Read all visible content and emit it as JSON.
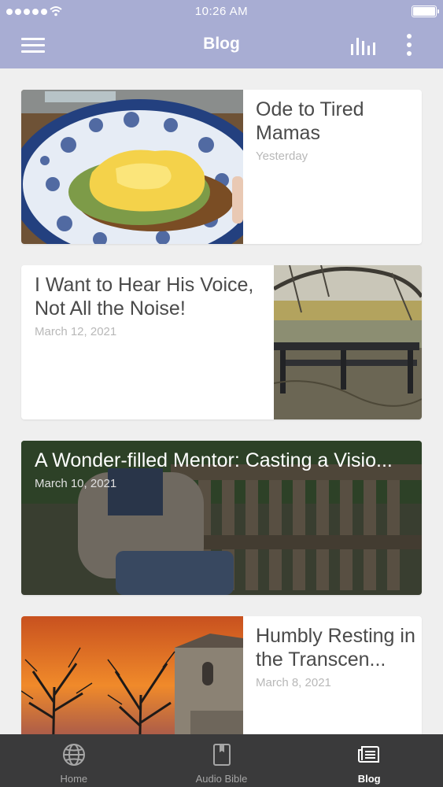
{
  "status_bar": {
    "time": "10:26 AM"
  },
  "nav": {
    "title": "Blog",
    "icons": [
      "menu-icon",
      "bar-chart-icon",
      "more-vertical-icon"
    ]
  },
  "posts": [
    {
      "title": "Ode to Tired Mamas",
      "date": "Yesterday"
    },
    {
      "title": "I Want to Hear His Voice, Not All the Noise!",
      "date": "March 12, 2021"
    },
    {
      "title": "A Wonder-filled Mentor: Casting a Visio...",
      "date": "March 10, 2021"
    },
    {
      "title": "Humbly Resting in the Transcen...",
      "date": "March 8, 2021"
    }
  ],
  "tabs": [
    {
      "label": "Home",
      "icon": "globe-icon"
    },
    {
      "label": "Audio Bible",
      "icon": "book-icon"
    },
    {
      "label": "Blog",
      "icon": "blog-icon",
      "active": true
    }
  ],
  "colors": {
    "header": "#a8add3",
    "tabbar": "#3a3a3b",
    "background": "#efefef",
    "title_text": "#4a4a4a",
    "date_text": "#b8b8b8"
  }
}
